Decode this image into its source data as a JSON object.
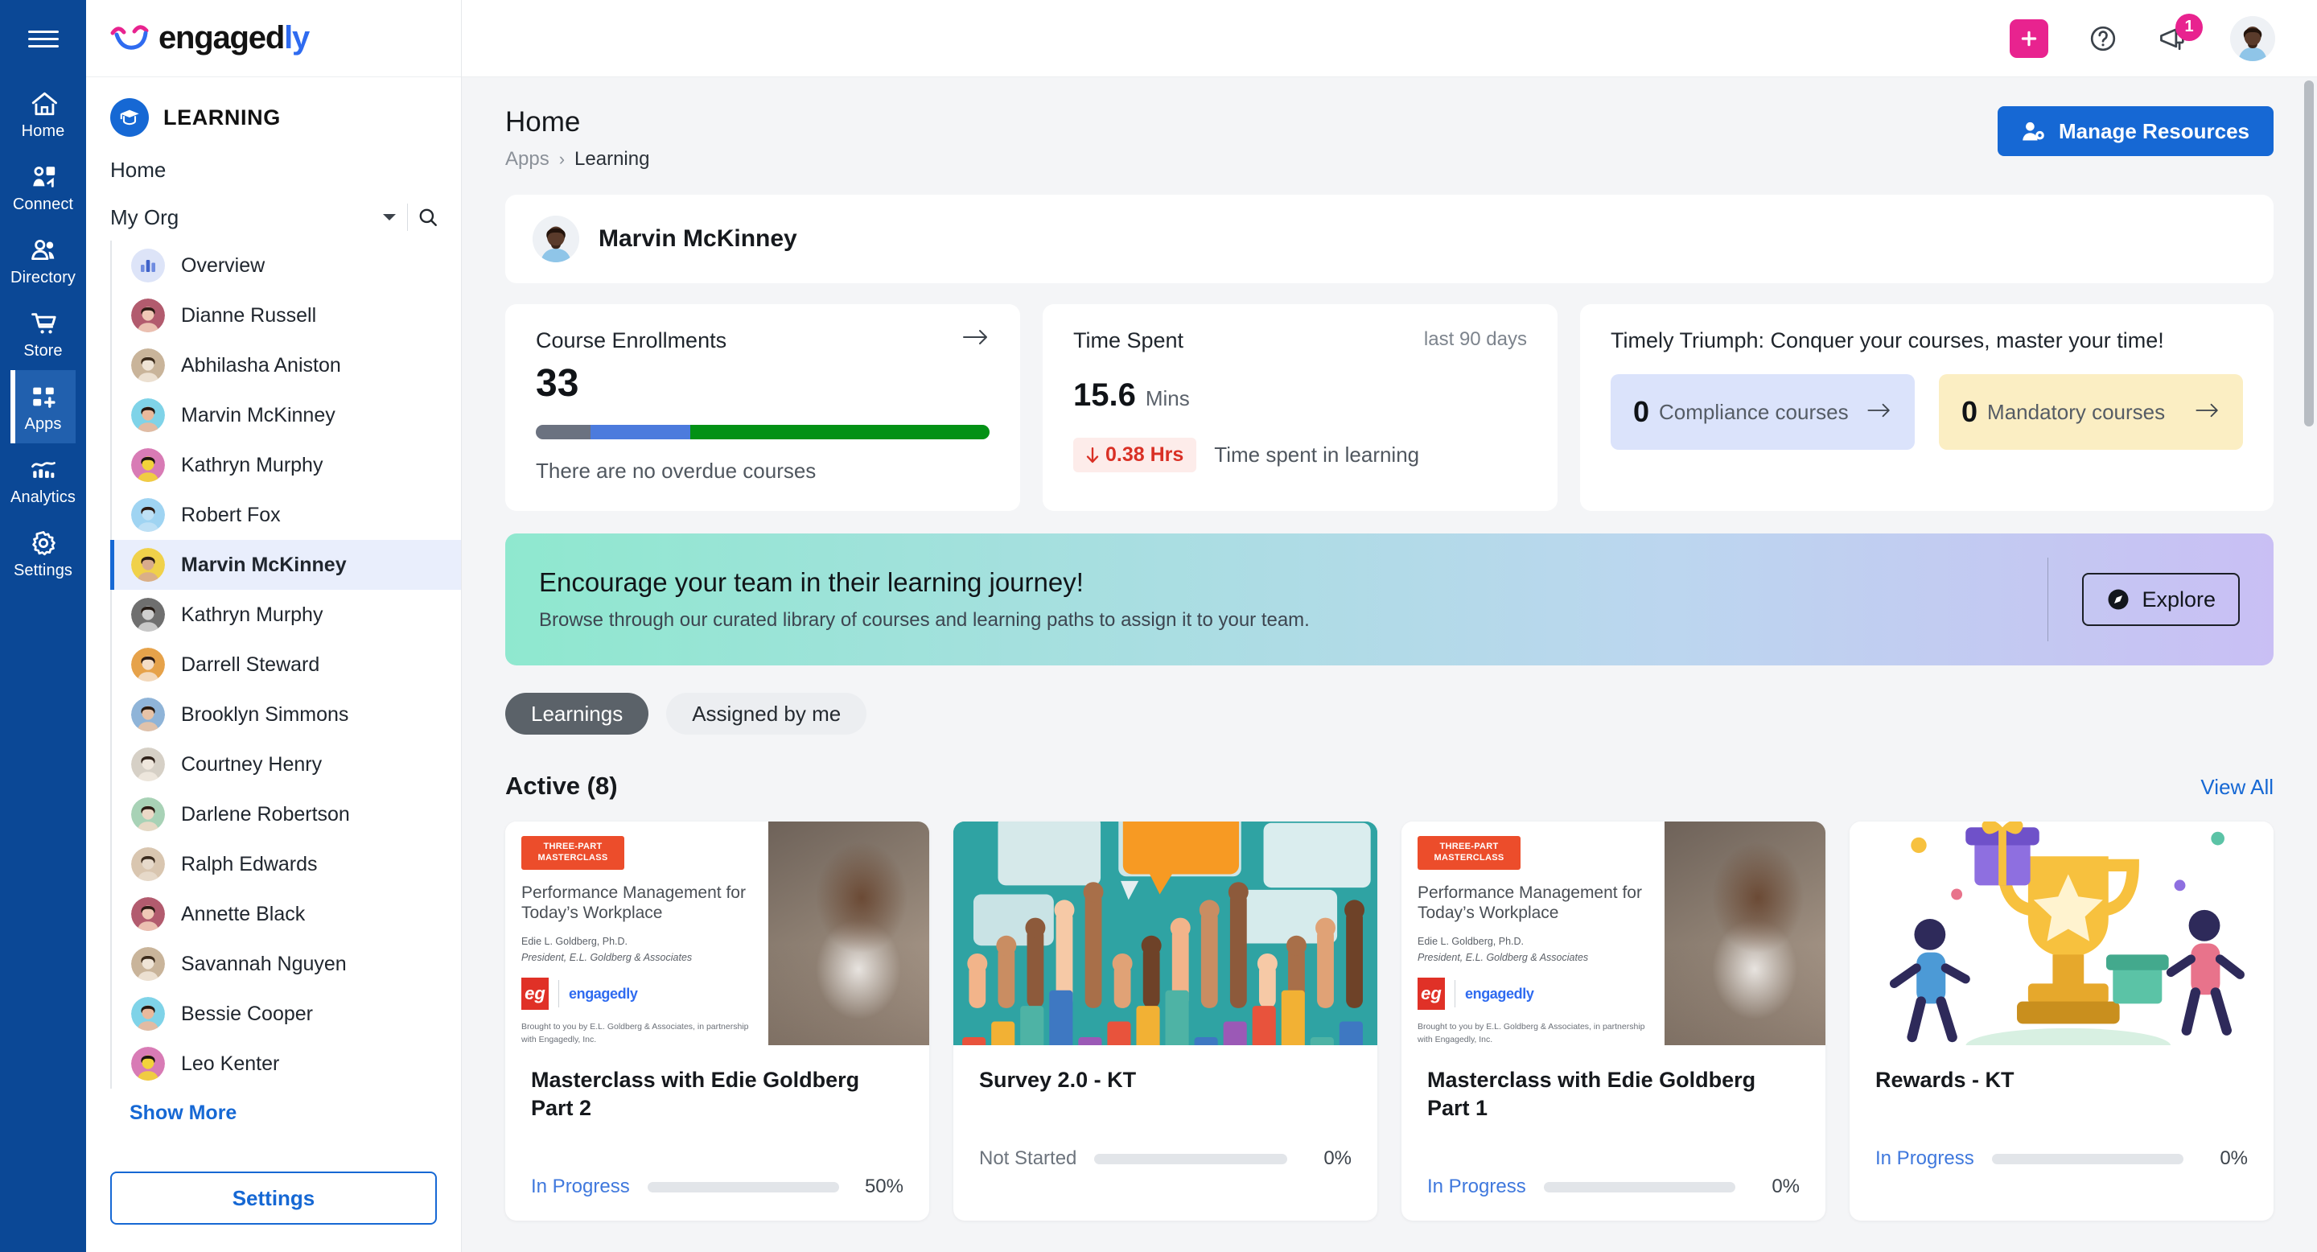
{
  "brand": {
    "name_dark": "engaged",
    "name_blue": "ly",
    "logo_icon": "engagedly-swoosh-icon"
  },
  "rail": {
    "burger": "menu-icon",
    "items": [
      {
        "label": "Home",
        "icon": "home-icon",
        "active": false
      },
      {
        "label": "Connect",
        "icon": "connect-icon",
        "active": false
      },
      {
        "label": "Directory",
        "icon": "directory-people-icon",
        "active": false
      },
      {
        "label": "Store",
        "icon": "store-cart-icon",
        "active": false
      },
      {
        "label": "Apps",
        "icon": "apps-grid-plus-icon",
        "active": true
      },
      {
        "label": "Analytics",
        "icon": "analytics-chart-icon",
        "active": false
      },
      {
        "label": "Settings",
        "icon": "gear-icon",
        "active": false
      }
    ]
  },
  "sidebar": {
    "app_title": "LEARNING",
    "app_icon": "graduation-cap-icon",
    "home_label": "Home",
    "org_label": "My Org",
    "dropdown_icon": "chevron-down-icon",
    "search_icon": "search-icon",
    "people": [
      {
        "label": "Overview",
        "type": "overview",
        "selected": false
      },
      {
        "label": "Dianne Russell",
        "type": "person",
        "selected": false
      },
      {
        "label": "Abhilasha Aniston",
        "type": "person",
        "selected": false
      },
      {
        "label": "Marvin McKinney",
        "type": "person",
        "selected": false
      },
      {
        "label": "Kathryn Murphy",
        "type": "person",
        "selected": false
      },
      {
        "label": "Robert Fox",
        "type": "person",
        "selected": false
      },
      {
        "label": "Marvin McKinney",
        "type": "person",
        "selected": true
      },
      {
        "label": "Kathryn Murphy",
        "type": "person",
        "selected": false
      },
      {
        "label": "Darrell Steward",
        "type": "person",
        "selected": false
      },
      {
        "label": "Brooklyn Simmons",
        "type": "person",
        "selected": false
      },
      {
        "label": "Courtney Henry",
        "type": "person",
        "selected": false
      },
      {
        "label": "Darlene Robertson",
        "type": "person",
        "selected": false
      },
      {
        "label": "Ralph Edwards",
        "type": "person",
        "selected": false
      },
      {
        "label": "Annette Black",
        "type": "person",
        "selected": false
      },
      {
        "label": "Savannah Nguyen",
        "type": "person",
        "selected": false
      },
      {
        "label": "Bessie Cooper",
        "type": "person",
        "selected": false
      },
      {
        "label": "Leo Kenter",
        "type": "person",
        "selected": false
      }
    ],
    "show_more": "Show More",
    "settings_button": "Settings"
  },
  "topbar": {
    "plus_icon": "plus-icon",
    "help_icon": "help-circle-icon",
    "announcement_icon": "megaphone-icon",
    "notification_count": "1",
    "avatar": "user-avatar"
  },
  "header": {
    "title": "Home",
    "breadcrumb": {
      "parent": "Apps",
      "separator": "›",
      "current": "Learning"
    },
    "manage_button": "Manage Resources",
    "manage_icon": "user-gear-icon"
  },
  "profile": {
    "name": "Marvin McKinney",
    "avatar": "marvin-avatar"
  },
  "stats": {
    "enrollments": {
      "title": "Course Enrollments",
      "value": "33",
      "note": "There are no overdue courses",
      "arrow_icon": "arrow-right-icon",
      "bar": {
        "gray_pct": 12,
        "blue_pct": 22,
        "green_pct": 66,
        "gray_color": "#6b7280",
        "blue_color": "#4c7bdd",
        "green_color": "#039115"
      }
    },
    "time_spent": {
      "title": "Time Spent",
      "range": "last 90 days",
      "value": "15.6",
      "unit": "Mins",
      "delta_icon": "arrow-down-icon",
      "delta": "0.38 Hrs",
      "delta_label": "Time spent in learning"
    },
    "triumph": {
      "title": "Timely Triumph: Conquer your courses, master your time!",
      "tiles": [
        {
          "count": "0",
          "label": "Compliance courses",
          "arrow_icon": "arrow-right-icon",
          "color": "#dbe3fb"
        },
        {
          "count": "0",
          "label": "Mandatory courses",
          "arrow_icon": "arrow-right-icon",
          "color": "#fbeec3"
        }
      ]
    }
  },
  "promo": {
    "title": "Encourage your team in their learning journey!",
    "subtitle": "Browse through our curated library of courses and learning paths to assign it to your team.",
    "button": "Explore",
    "button_icon": "compass-icon"
  },
  "tabs": [
    {
      "label": "Learnings",
      "active": true
    },
    {
      "label": "Assigned by me",
      "active": false
    }
  ],
  "section": {
    "title": "Active (8)",
    "view_all": "View All"
  },
  "courses": [
    {
      "name": "Masterclass with Edie Goldberg Part 2",
      "status": "In Progress",
      "status_type": "inprogress",
      "percent": "50%",
      "percent_value": 50,
      "thumb": "masterclass-performance-management",
      "thumb_text": {
        "tag": "THREE-PART MASTERCLASS",
        "heading": "Performance Management for Today’s Workplace",
        "author": "Edie L. Goldberg, Ph.D.",
        "author_role": "President, E.L. Goldberg & Associates",
        "partner": "Brought to you by E.L. Goldberg & Associates, in partnership with Engagedly, Inc."
      }
    },
    {
      "name": "Survey 2.0 - KT",
      "status": "Not Started",
      "status_type": "notstarted",
      "percent": "0%",
      "percent_value": 0,
      "thumb": "survey-hands-speech-bubbles"
    },
    {
      "name": "Masterclass with Edie Goldberg Part 1",
      "status": "In Progress",
      "status_type": "inprogress",
      "percent": "0%",
      "percent_value": 0,
      "thumb": "masterclass-performance-management",
      "thumb_text": {
        "tag": "THREE-PART MASTERCLASS",
        "heading": "Performance Management for Today’s Workplace",
        "author": "Edie L. Goldberg, Ph.D.",
        "author_role": "President, E.L. Goldberg & Associates",
        "partner": "Brought to you by E.L. Goldberg & Associates, in partnership with Engagedly, Inc."
      }
    },
    {
      "name": "Rewards - KT",
      "status": "In Progress",
      "status_type": "inprogress",
      "percent": "0%",
      "percent_value": 0,
      "thumb": "rewards-trophy-illustration"
    }
  ]
}
